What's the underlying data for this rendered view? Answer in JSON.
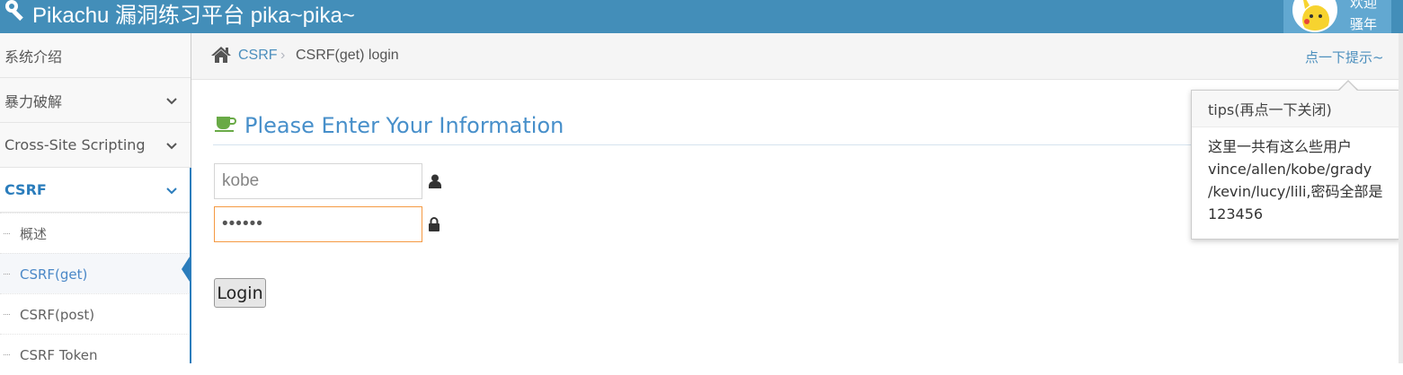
{
  "header": {
    "title": "Pikachu 漏洞练习平台 pika~pika~",
    "user_line1": "欢迎",
    "user_line2": "骚年",
    "icon": "wrench-icon",
    "background": "#438eb9"
  },
  "sidebar": {
    "items": [
      {
        "label": "系统介绍"
      },
      {
        "label": "暴力破解"
      },
      {
        "label": "Cross-Site Scripting"
      },
      {
        "label": "CSRF"
      }
    ],
    "csrf_sub": [
      {
        "label": "概述"
      },
      {
        "label": "CSRF(get)"
      },
      {
        "label": "CSRF(post)"
      },
      {
        "label": "CSRF Token"
      }
    ],
    "active_color": "#2b7dbc"
  },
  "breadcrumb": {
    "parent": "CSRF",
    "separator": "›",
    "current": "CSRF(get) login",
    "tips_link": "点一下提示~"
  },
  "form": {
    "title": "Please Enter Your Information",
    "username_value": "kobe",
    "password_mask": "••••••",
    "login_label": "Login",
    "title_color": "#478fca"
  },
  "popover": {
    "title": "tips(再点一下关闭)",
    "line1": "这里一共有这么些用户",
    "line2": "vince/allen/kobe/grady",
    "line3": "/kevin/lucy/lili,密码全部是",
    "line4": "123456"
  }
}
